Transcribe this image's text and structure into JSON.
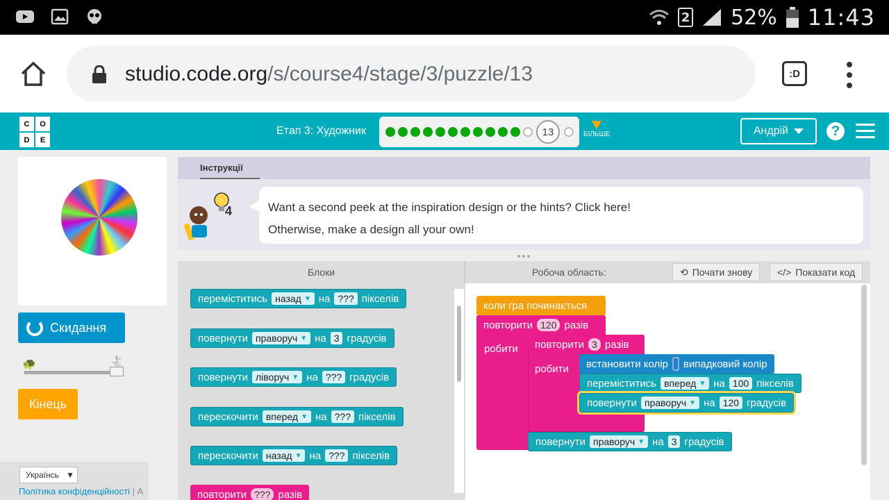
{
  "status_bar": {
    "signal_badge": "2",
    "battery": "52%",
    "time": "11:43"
  },
  "browser": {
    "url_host": "studio.code.org",
    "url_path": "/s/course4/stage/3/puzzle/13",
    "tab_switch_label": ":D"
  },
  "header": {
    "logo_letters": [
      "C",
      "O",
      "D",
      "E"
    ],
    "stage_title": "Етап 3: Художник",
    "progress": {
      "completed": 11,
      "current": "13",
      "more_label": "БІЛЬШЕ"
    },
    "user_label": "Андрій",
    "help_label": "?"
  },
  "left": {
    "reset_label": "Скидання",
    "finish_label": "Кінець",
    "language": "Українсь",
    "privacy_link": "Політика конфіденційності",
    "privacy_sep": "|",
    "cut_link": "A"
  },
  "instructions": {
    "tab_label": "Інструкції",
    "hint_count": "4",
    "line1": "Want a second peek at the inspiration design or the hints? Click here!",
    "line2": "Otherwise, make a design all your own!"
  },
  "workspace_header": {
    "toolbox_label": "Блоки",
    "workspace_label": "Робоча область:",
    "restart_label": "Почати знову",
    "show_code_label": "Показати код"
  },
  "toolbox": {
    "b1": {
      "verb": "переміститись",
      "dir": "назад",
      "on": "на",
      "val": "???",
      "unit": "пікселів"
    },
    "b2": {
      "verb": "повернути",
      "dir": "праворуч",
      "on": "на",
      "val": "3",
      "unit": "градусів"
    },
    "b3": {
      "verb": "повернути",
      "dir": "ліворуч",
      "on": "на",
      "val": "???",
      "unit": "градусів"
    },
    "b4": {
      "verb": "перескочити",
      "dir": "вперед",
      "on": "на",
      "val": "???",
      "unit": "пікселів"
    },
    "b5": {
      "verb": "перескочити",
      "dir": "назад",
      "on": "на",
      "val": "???",
      "unit": "пікселів"
    },
    "b6": {
      "verb": "повторити",
      "val": "???",
      "unit": "разів"
    }
  },
  "program": {
    "when_run": "коли гра починається",
    "repeat1": {
      "verb": "повторити",
      "val": "120",
      "unit": "разів",
      "do": "робити"
    },
    "repeat2": {
      "verb": "повторити",
      "val": "3",
      "unit": "разів",
      "do": "робити"
    },
    "set_color": {
      "verb": "встановити колір",
      "value": "випадковий колір"
    },
    "move": {
      "verb": "переміститись",
      "dir": "вперед",
      "on": "на",
      "val": "100",
      "unit": "пікселів"
    },
    "turn_inner": {
      "verb": "повернути",
      "dir": "праворуч",
      "on": "на",
      "val": "120",
      "unit": "градусів"
    },
    "turn_outer": {
      "verb": "повернути",
      "dir": "праворуч",
      "on": "на",
      "val": "3",
      "unit": "градусів"
    }
  }
}
